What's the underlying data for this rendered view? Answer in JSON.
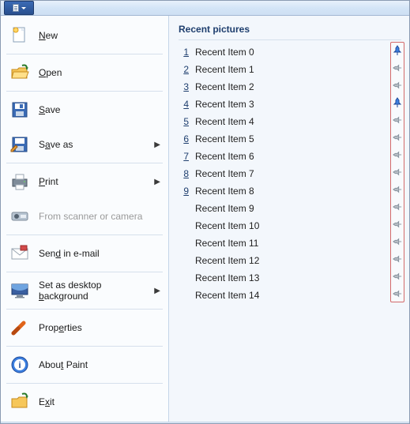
{
  "menu": {
    "items": [
      {
        "label": "New",
        "accel": "N",
        "submenu": false,
        "disabled": false,
        "icon": "new-icon"
      },
      {
        "label": "Open",
        "accel": "O",
        "submenu": false,
        "disabled": false,
        "icon": "open-icon"
      },
      {
        "label": "Save",
        "accel": "S",
        "submenu": false,
        "disabled": false,
        "icon": "save-icon"
      },
      {
        "label": "Save as",
        "accel": "a",
        "submenu": true,
        "disabled": false,
        "icon": "saveas-icon"
      },
      {
        "label": "Print",
        "accel": "P",
        "submenu": true,
        "disabled": false,
        "icon": "print-icon"
      },
      {
        "label": "From scanner or camera",
        "accel": "",
        "submenu": false,
        "disabled": true,
        "icon": "scanner-icon"
      },
      {
        "label": "Send in e-mail",
        "accel": "d",
        "submenu": false,
        "disabled": false,
        "icon": "email-icon"
      },
      {
        "label": "Set as desktop background",
        "accel": "b",
        "submenu": true,
        "disabled": false,
        "icon": "desktop-icon"
      },
      {
        "label": "Properties",
        "accel": "e",
        "submenu": false,
        "disabled": false,
        "icon": "properties-icon"
      },
      {
        "label": "About Paint",
        "accel": "t",
        "submenu": false,
        "disabled": false,
        "icon": "about-icon"
      },
      {
        "label": "Exit",
        "accel": "x",
        "submenu": false,
        "disabled": false,
        "icon": "exit-icon"
      }
    ],
    "separators_after": [
      0,
      1,
      3,
      5,
      6,
      7,
      8,
      9
    ]
  },
  "recent": {
    "heading": "Recent pictures",
    "items": [
      {
        "n": "1",
        "name": "Recent Item 0",
        "pinned": true
      },
      {
        "n": "2",
        "name": "Recent Item 1",
        "pinned": false
      },
      {
        "n": "3",
        "name": "Recent Item 2",
        "pinned": false
      },
      {
        "n": "4",
        "name": "Recent Item 3",
        "pinned": true
      },
      {
        "n": "5",
        "name": "Recent Item 4",
        "pinned": false
      },
      {
        "n": "6",
        "name": "Recent Item 5",
        "pinned": false
      },
      {
        "n": "7",
        "name": "Recent Item 6",
        "pinned": false
      },
      {
        "n": "8",
        "name": "Recent Item 7",
        "pinned": false
      },
      {
        "n": "9",
        "name": "Recent Item 8",
        "pinned": false
      },
      {
        "n": "",
        "name": "Recent Item 9",
        "pinned": false
      },
      {
        "n": "",
        "name": "Recent Item 10",
        "pinned": false
      },
      {
        "n": "",
        "name": "Recent Item 11",
        "pinned": false
      },
      {
        "n": "",
        "name": "Recent Item 12",
        "pinned": false
      },
      {
        "n": "",
        "name": "Recent Item 13",
        "pinned": false
      },
      {
        "n": "",
        "name": "Recent Item 14",
        "pinned": false
      }
    ]
  }
}
